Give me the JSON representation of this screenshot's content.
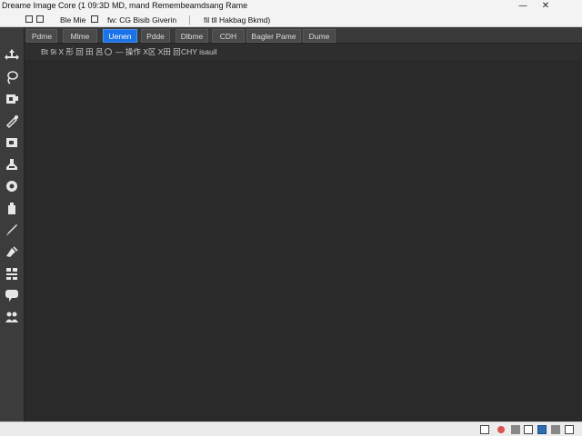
{
  "window": {
    "title": "Dreame Image Core  (1 09:3D MD, mand Remembeamdsang Rame",
    "minimize_glyph": "—",
    "close_glyph": "✕"
  },
  "menubar": {
    "items": [
      {
        "label": "Ble Mie"
      },
      {
        "label": "fw: CG Bisib Giverin"
      },
      {
        "label": "fil tll Hakbag  Bkmd)"
      }
    ]
  },
  "tabs": [
    {
      "label": "Pdme"
    },
    {
      "label": "Mlme"
    },
    {
      "label": "Uenen"
    },
    {
      "label": "Pdde"
    },
    {
      "label": "Dlbme"
    },
    {
      "label": "CDH"
    },
    {
      "label": "Bagler Pame"
    },
    {
      "label": "Dume"
    }
  ],
  "active_tab_index": 2,
  "options": {
    "left_group": "Bt 9i  X 形 回 田 呂",
    "right_group": "— 操作 X区 X田 回",
    "field": "CHY  isauil"
  },
  "toolbar": {
    "tools": [
      {
        "icon": "move-icon"
      },
      {
        "icon": "lasso-icon"
      },
      {
        "icon": "crop-icon"
      },
      {
        "icon": "eyedropper-icon"
      },
      {
        "icon": "frame-icon"
      },
      {
        "icon": "stamp-icon"
      },
      {
        "icon": "blur-icon"
      },
      {
        "icon": "bucket-icon"
      },
      {
        "icon": "brush-icon"
      },
      {
        "icon": "pen-icon"
      },
      {
        "icon": "transform-icon"
      },
      {
        "icon": "speech-icon"
      },
      {
        "icon": "people-icon"
      }
    ]
  },
  "statusbar": {
    "tray_icons": [
      "terminal-icon",
      "record-icon",
      "network-icon",
      "storage-icon",
      "display-icon",
      "cloud-icon",
      "user-icon"
    ]
  }
}
